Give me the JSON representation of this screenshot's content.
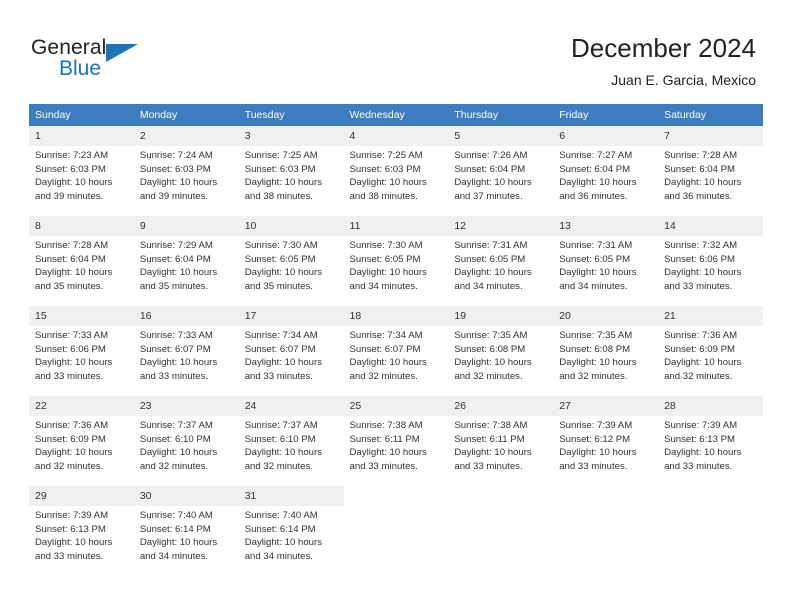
{
  "brand": {
    "name_part1": "General",
    "name_part2": "Blue",
    "logo_icon": "triangle-logo-icon",
    "accent_color": "#1b75bb"
  },
  "header": {
    "title": "December 2024",
    "subtitle": "Juan E. Garcia, Mexico"
  },
  "theme": {
    "header_blue": "#3d7cbf",
    "daynum_gray": "#f0f0f0",
    "text_color": "#333333"
  },
  "calendar": {
    "weekday_headers": [
      "Sunday",
      "Monday",
      "Tuesday",
      "Wednesday",
      "Thursday",
      "Friday",
      "Saturday"
    ],
    "weeks": [
      [
        {
          "day": "1",
          "sunrise": "Sunrise: 7:23 AM",
          "sunset": "Sunset: 6:03 PM",
          "daylight_line1": "Daylight: 10 hours",
          "daylight_line2": "and 39 minutes."
        },
        {
          "day": "2",
          "sunrise": "Sunrise: 7:24 AM",
          "sunset": "Sunset: 6:03 PM",
          "daylight_line1": "Daylight: 10 hours",
          "daylight_line2": "and 39 minutes."
        },
        {
          "day": "3",
          "sunrise": "Sunrise: 7:25 AM",
          "sunset": "Sunset: 6:03 PM",
          "daylight_line1": "Daylight: 10 hours",
          "daylight_line2": "and 38 minutes."
        },
        {
          "day": "4",
          "sunrise": "Sunrise: 7:25 AM",
          "sunset": "Sunset: 6:03 PM",
          "daylight_line1": "Daylight: 10 hours",
          "daylight_line2": "and 38 minutes."
        },
        {
          "day": "5",
          "sunrise": "Sunrise: 7:26 AM",
          "sunset": "Sunset: 6:04 PM",
          "daylight_line1": "Daylight: 10 hours",
          "daylight_line2": "and 37 minutes."
        },
        {
          "day": "6",
          "sunrise": "Sunrise: 7:27 AM",
          "sunset": "Sunset: 6:04 PM",
          "daylight_line1": "Daylight: 10 hours",
          "daylight_line2": "and 36 minutes."
        },
        {
          "day": "7",
          "sunrise": "Sunrise: 7:28 AM",
          "sunset": "Sunset: 6:04 PM",
          "daylight_line1": "Daylight: 10 hours",
          "daylight_line2": "and 36 minutes."
        }
      ],
      [
        {
          "day": "8",
          "sunrise": "Sunrise: 7:28 AM",
          "sunset": "Sunset: 6:04 PM",
          "daylight_line1": "Daylight: 10 hours",
          "daylight_line2": "and 35 minutes."
        },
        {
          "day": "9",
          "sunrise": "Sunrise: 7:29 AM",
          "sunset": "Sunset: 6:04 PM",
          "daylight_line1": "Daylight: 10 hours",
          "daylight_line2": "and 35 minutes."
        },
        {
          "day": "10",
          "sunrise": "Sunrise: 7:30 AM",
          "sunset": "Sunset: 6:05 PM",
          "daylight_line1": "Daylight: 10 hours",
          "daylight_line2": "and 35 minutes."
        },
        {
          "day": "11",
          "sunrise": "Sunrise: 7:30 AM",
          "sunset": "Sunset: 6:05 PM",
          "daylight_line1": "Daylight: 10 hours",
          "daylight_line2": "and 34 minutes."
        },
        {
          "day": "12",
          "sunrise": "Sunrise: 7:31 AM",
          "sunset": "Sunset: 6:05 PM",
          "daylight_line1": "Daylight: 10 hours",
          "daylight_line2": "and 34 minutes."
        },
        {
          "day": "13",
          "sunrise": "Sunrise: 7:31 AM",
          "sunset": "Sunset: 6:05 PM",
          "daylight_line1": "Daylight: 10 hours",
          "daylight_line2": "and 34 minutes."
        },
        {
          "day": "14",
          "sunrise": "Sunrise: 7:32 AM",
          "sunset": "Sunset: 6:06 PM",
          "daylight_line1": "Daylight: 10 hours",
          "daylight_line2": "and 33 minutes."
        }
      ],
      [
        {
          "day": "15",
          "sunrise": "Sunrise: 7:33 AM",
          "sunset": "Sunset: 6:06 PM",
          "daylight_line1": "Daylight: 10 hours",
          "daylight_line2": "and 33 minutes."
        },
        {
          "day": "16",
          "sunrise": "Sunrise: 7:33 AM",
          "sunset": "Sunset: 6:07 PM",
          "daylight_line1": "Daylight: 10 hours",
          "daylight_line2": "and 33 minutes."
        },
        {
          "day": "17",
          "sunrise": "Sunrise: 7:34 AM",
          "sunset": "Sunset: 6:07 PM",
          "daylight_line1": "Daylight: 10 hours",
          "daylight_line2": "and 33 minutes."
        },
        {
          "day": "18",
          "sunrise": "Sunrise: 7:34 AM",
          "sunset": "Sunset: 6:07 PM",
          "daylight_line1": "Daylight: 10 hours",
          "daylight_line2": "and 32 minutes."
        },
        {
          "day": "19",
          "sunrise": "Sunrise: 7:35 AM",
          "sunset": "Sunset: 6:08 PM",
          "daylight_line1": "Daylight: 10 hours",
          "daylight_line2": "and 32 minutes."
        },
        {
          "day": "20",
          "sunrise": "Sunrise: 7:35 AM",
          "sunset": "Sunset: 6:08 PM",
          "daylight_line1": "Daylight: 10 hours",
          "daylight_line2": "and 32 minutes."
        },
        {
          "day": "21",
          "sunrise": "Sunrise: 7:36 AM",
          "sunset": "Sunset: 6:09 PM",
          "daylight_line1": "Daylight: 10 hours",
          "daylight_line2": "and 32 minutes."
        }
      ],
      [
        {
          "day": "22",
          "sunrise": "Sunrise: 7:36 AM",
          "sunset": "Sunset: 6:09 PM",
          "daylight_line1": "Daylight: 10 hours",
          "daylight_line2": "and 32 minutes."
        },
        {
          "day": "23",
          "sunrise": "Sunrise: 7:37 AM",
          "sunset": "Sunset: 6:10 PM",
          "daylight_line1": "Daylight: 10 hours",
          "daylight_line2": "and 32 minutes."
        },
        {
          "day": "24",
          "sunrise": "Sunrise: 7:37 AM",
          "sunset": "Sunset: 6:10 PM",
          "daylight_line1": "Daylight: 10 hours",
          "daylight_line2": "and 32 minutes."
        },
        {
          "day": "25",
          "sunrise": "Sunrise: 7:38 AM",
          "sunset": "Sunset: 6:11 PM",
          "daylight_line1": "Daylight: 10 hours",
          "daylight_line2": "and 33 minutes."
        },
        {
          "day": "26",
          "sunrise": "Sunrise: 7:38 AM",
          "sunset": "Sunset: 6:11 PM",
          "daylight_line1": "Daylight: 10 hours",
          "daylight_line2": "and 33 minutes."
        },
        {
          "day": "27",
          "sunrise": "Sunrise: 7:39 AM",
          "sunset": "Sunset: 6:12 PM",
          "daylight_line1": "Daylight: 10 hours",
          "daylight_line2": "and 33 minutes."
        },
        {
          "day": "28",
          "sunrise": "Sunrise: 7:39 AM",
          "sunset": "Sunset: 6:13 PM",
          "daylight_line1": "Daylight: 10 hours",
          "daylight_line2": "and 33 minutes."
        }
      ],
      [
        {
          "day": "29",
          "sunrise": "Sunrise: 7:39 AM",
          "sunset": "Sunset: 6:13 PM",
          "daylight_line1": "Daylight: 10 hours",
          "daylight_line2": "and 33 minutes."
        },
        {
          "day": "30",
          "sunrise": "Sunrise: 7:40 AM",
          "sunset": "Sunset: 6:14 PM",
          "daylight_line1": "Daylight: 10 hours",
          "daylight_line2": "and 34 minutes."
        },
        {
          "day": "31",
          "sunrise": "Sunrise: 7:40 AM",
          "sunset": "Sunset: 6:14 PM",
          "daylight_line1": "Daylight: 10 hours",
          "daylight_line2": "and 34 minutes."
        },
        {
          "day": "",
          "sunrise": "",
          "sunset": "",
          "daylight_line1": "",
          "daylight_line2": ""
        },
        {
          "day": "",
          "sunrise": "",
          "sunset": "",
          "daylight_line1": "",
          "daylight_line2": ""
        },
        {
          "day": "",
          "sunrise": "",
          "sunset": "",
          "daylight_line1": "",
          "daylight_line2": ""
        },
        {
          "day": "",
          "sunrise": "",
          "sunset": "",
          "daylight_line1": "",
          "daylight_line2": ""
        }
      ]
    ]
  }
}
